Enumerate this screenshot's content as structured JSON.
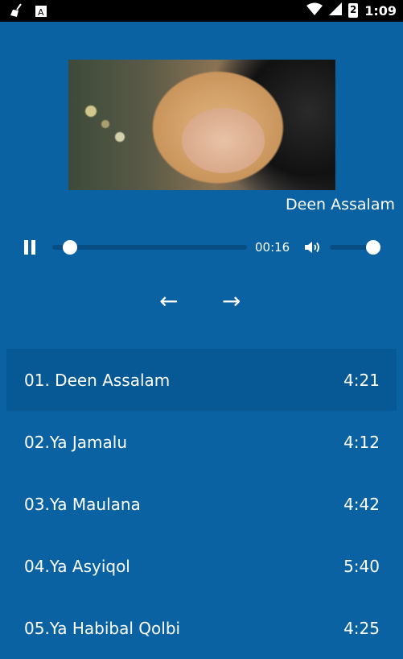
{
  "status_bar": {
    "time": "1:09",
    "battery_level": "2",
    "icons": [
      "broom-icon",
      "a-icon",
      "wifi-icon",
      "signal-icon",
      "battery-icon"
    ]
  },
  "player": {
    "now_playing": "Deen Assalam",
    "elapsed": "00:16",
    "progress_fraction": 0.09,
    "volume_fraction": 0.85,
    "prev_label": "←",
    "next_label": "→"
  },
  "playlist": [
    {
      "title": "01. Deen Assalam",
      "duration": "4:21",
      "active": true
    },
    {
      "title": "02.Ya Jamalu",
      "duration": "4:12",
      "active": false
    },
    {
      "title": "03.Ya Maulana",
      "duration": "4:42",
      "active": false
    },
    {
      "title": "04.Ya Asyiqol",
      "duration": "5:40",
      "active": false
    },
    {
      "title": "05.Ya Habibal Qolbi",
      "duration": "4:25",
      "active": false
    }
  ],
  "colors": {
    "background": "#0a62a3",
    "active_row": "#065995",
    "track": "#064e84"
  }
}
